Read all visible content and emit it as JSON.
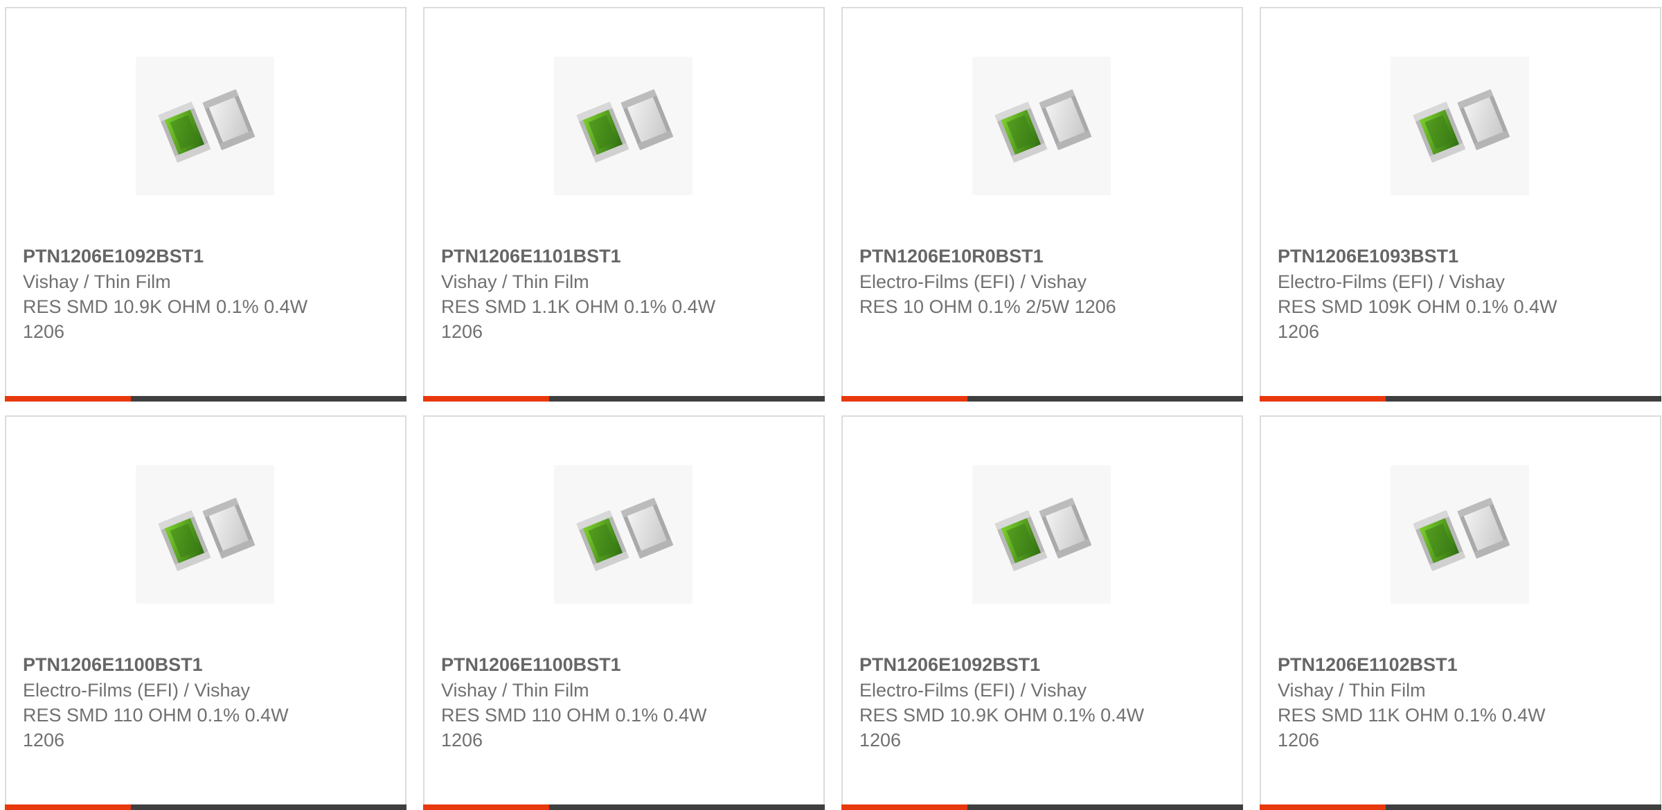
{
  "colors": {
    "accent": "#e8380d",
    "bar": "#3f3f3f",
    "border": "#dcdcdc",
    "text": "#707070"
  },
  "products": [
    {
      "part_number": "PTN1206E1092BST1",
      "manufacturer": "Vishay / Thin Film",
      "description": "RES SMD 10.9K OHM 0.1% 0.4W 1206",
      "image_icon": "smd-resistor-image"
    },
    {
      "part_number": "PTN1206E1101BST1",
      "manufacturer": "Vishay / Thin Film",
      "description": "RES SMD 1.1K OHM 0.1% 0.4W 1206",
      "image_icon": "smd-resistor-image"
    },
    {
      "part_number": "PTN1206E10R0BST1",
      "manufacturer": "Electro-Films (EFI) / Vishay",
      "description": "RES 10 OHM 0.1% 2/5W 1206",
      "image_icon": "smd-resistor-image"
    },
    {
      "part_number": "PTN1206E1093BST1",
      "manufacturer": "Electro-Films (EFI) / Vishay",
      "description": "RES SMD 109K OHM 0.1% 0.4W 1206",
      "image_icon": "smd-resistor-image"
    },
    {
      "part_number": "PTN1206E1100BST1",
      "manufacturer": "Electro-Films (EFI) / Vishay",
      "description": "RES SMD 110 OHM 0.1% 0.4W 1206",
      "image_icon": "smd-resistor-image"
    },
    {
      "part_number": "PTN1206E1100BST1",
      "manufacturer": "Vishay / Thin Film",
      "description": "RES SMD 110 OHM 0.1% 0.4W 1206",
      "image_icon": "smd-resistor-image"
    },
    {
      "part_number": "PTN1206E1092BST1",
      "manufacturer": "Electro-Films (EFI) / Vishay",
      "description": "RES SMD 10.9K OHM 0.1% 0.4W 1206",
      "image_icon": "smd-resistor-image"
    },
    {
      "part_number": "PTN1206E1102BST1",
      "manufacturer": "Vishay / Thin Film",
      "description": "RES SMD 11K OHM 0.1% 0.4W 1206",
      "image_icon": "smd-resistor-image"
    }
  ]
}
